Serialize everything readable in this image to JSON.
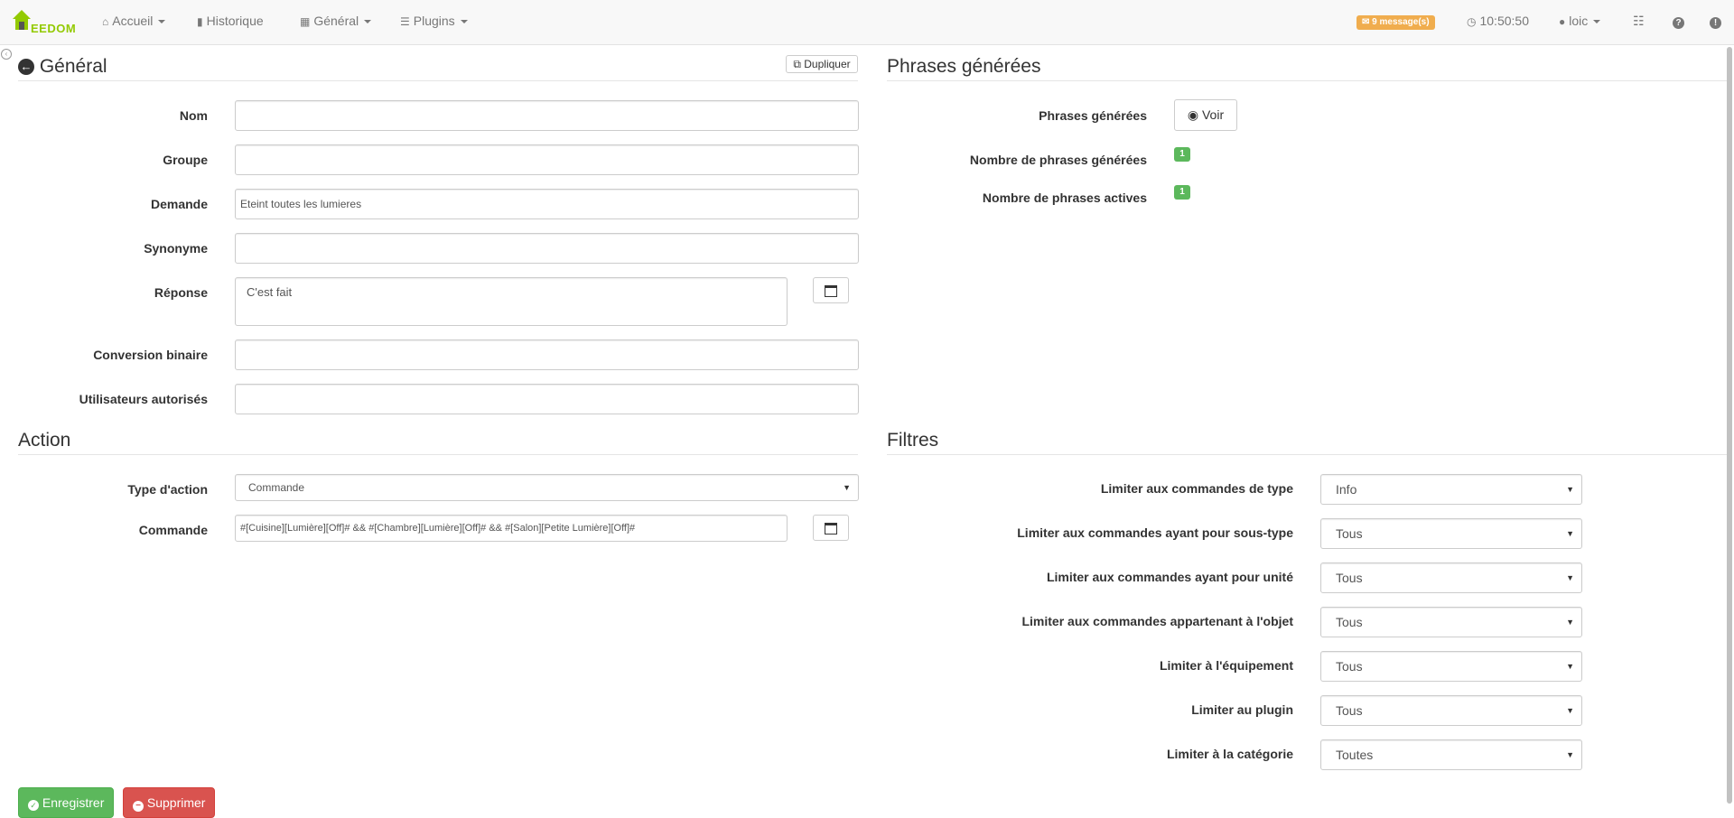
{
  "navbar": {
    "logo_text": "EEDOM",
    "items": [
      {
        "label": "Accueil",
        "icon": "home-icon"
      },
      {
        "label": "Historique",
        "icon": "bar-chart-icon"
      },
      {
        "label": "Général",
        "icon": "grid-icon"
      },
      {
        "label": "Plugins",
        "icon": "list-icon"
      }
    ],
    "messages": "9 message(s)",
    "time": "10:50:50",
    "user": "loic"
  },
  "general": {
    "title": "Général",
    "duplicate_label": "Dupliquer",
    "fields": {
      "nom": {
        "label": "Nom",
        "value": ""
      },
      "groupe": {
        "label": "Groupe",
        "value": ""
      },
      "demande": {
        "label": "Demande",
        "value": "Eteint toutes les lumieres"
      },
      "synonyme": {
        "label": "Synonyme",
        "value": ""
      },
      "reponse": {
        "label": "Réponse",
        "value": "C'est fait"
      },
      "conversion": {
        "label": "Conversion binaire",
        "value": ""
      },
      "utilisateurs": {
        "label": "Utilisateurs autorisés",
        "value": ""
      }
    }
  },
  "phrases": {
    "title": "Phrases générées",
    "generated_label": "Phrases générées",
    "voir_label": "Voir",
    "nb_generated_label": "Nombre de phrases générées",
    "nb_generated": "1",
    "nb_active_label": "Nombre de phrases actives",
    "nb_active": "1"
  },
  "action": {
    "title": "Action",
    "type_label": "Type d'action",
    "type_value": "Commande",
    "commande_label": "Commande",
    "commande_value": "#[Cuisine][Lumière][Off]# && #[Chambre][Lumière][Off]# && #[Salon][Petite Lumière][Off]#"
  },
  "filtres": {
    "title": "Filtres",
    "items": [
      {
        "label": "Limiter aux commandes de type",
        "value": "Info"
      },
      {
        "label": "Limiter aux commandes ayant pour sous-type",
        "value": "Tous"
      },
      {
        "label": "Limiter aux commandes ayant pour unité",
        "value": "Tous"
      },
      {
        "label": "Limiter aux commandes appartenant à l'objet",
        "value": "Tous"
      },
      {
        "label": "Limiter à l'équipement",
        "value": "Tous"
      },
      {
        "label": "Limiter au plugin",
        "value": "Tous"
      },
      {
        "label": "Limiter à la catégorie",
        "value": "Toutes"
      }
    ]
  },
  "footer": {
    "save_label": "Enregistrer",
    "delete_label": "Supprimer"
  }
}
